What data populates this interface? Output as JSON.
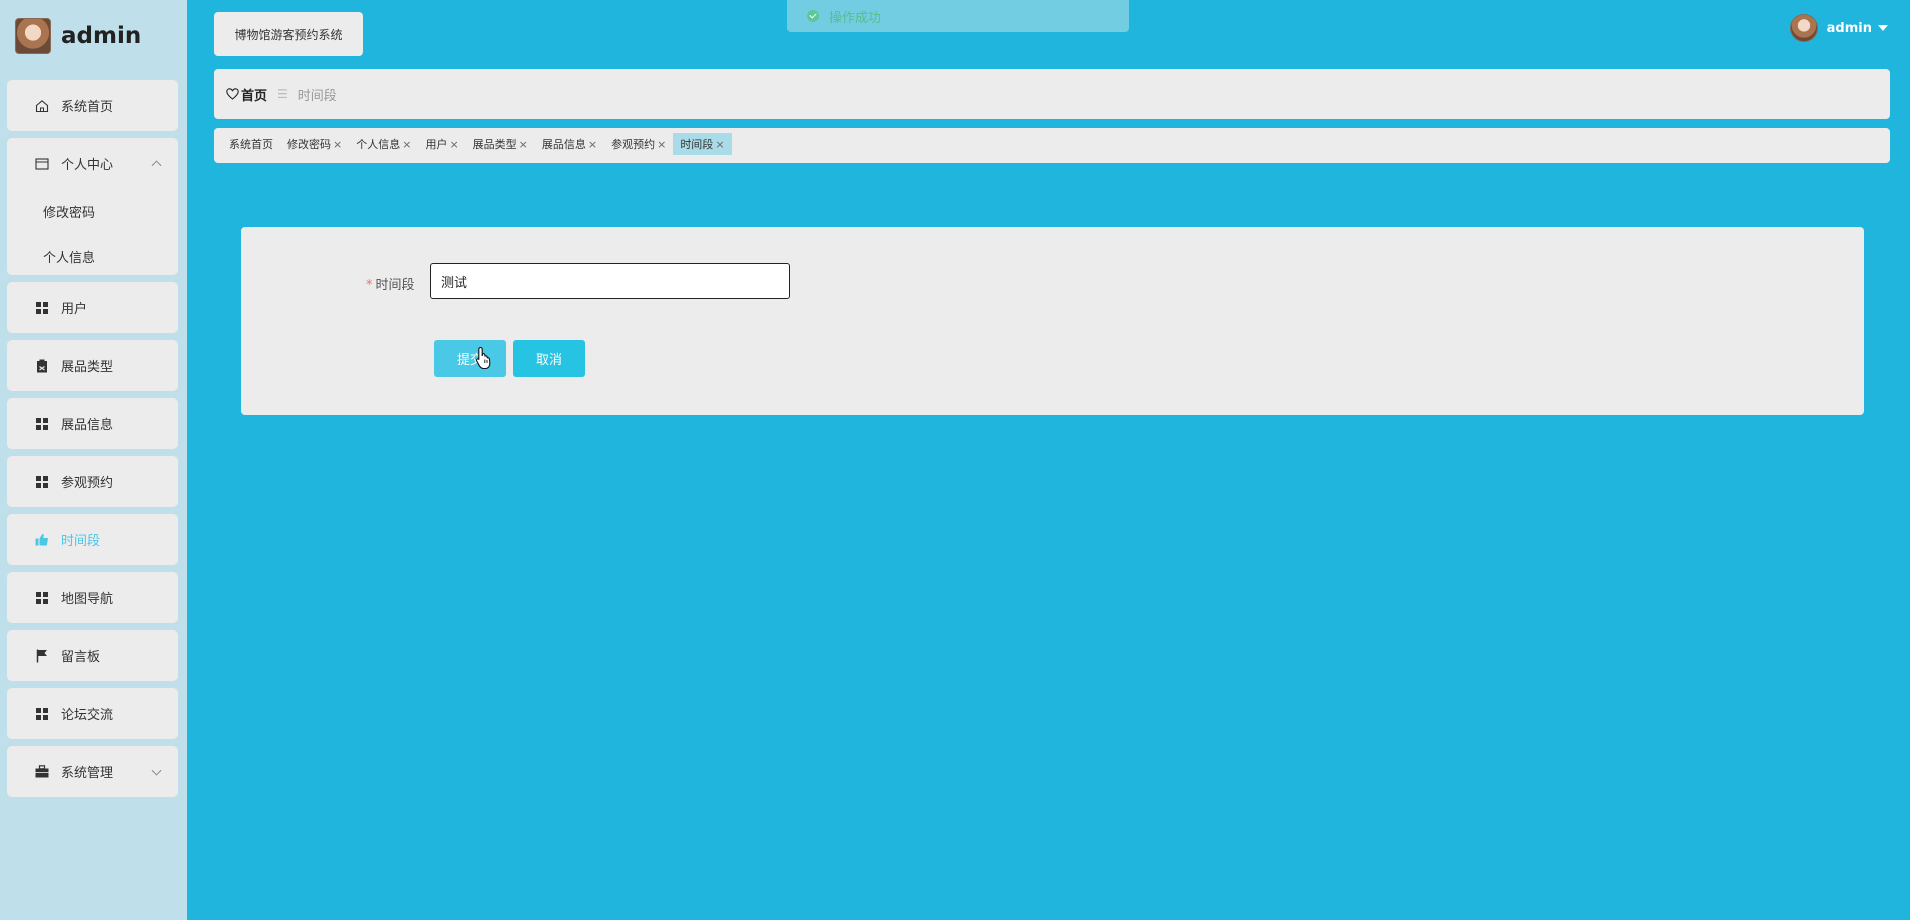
{
  "brand": {
    "name": "admin"
  },
  "header": {
    "system_title": "博物馆游客预约系统",
    "toast": "操作成功",
    "user_name": "admin"
  },
  "sidebar": {
    "home": "系统首页",
    "personal_center": {
      "label": "个人中心",
      "children": [
        "修改密码",
        "个人信息"
      ]
    },
    "items": [
      {
        "label": "用户",
        "icon": "grid-icon"
      },
      {
        "label": "展品类型",
        "icon": "clipboard-icon"
      },
      {
        "label": "展品信息",
        "icon": "grid-icon"
      },
      {
        "label": "参观预约",
        "icon": "grid-icon"
      },
      {
        "label": "时间段",
        "icon": "thumb-icon",
        "active": true
      },
      {
        "label": "地图导航",
        "icon": "grid-icon"
      },
      {
        "label": "留言板",
        "icon": "flag-icon"
      },
      {
        "label": "论坛交流",
        "icon": "grid-icon"
      }
    ],
    "system_management": "系统管理"
  },
  "breadcrumb": {
    "home": "首页",
    "separator": "☰",
    "current": "时间段"
  },
  "tabs": [
    {
      "label": "系统首页",
      "closable": false
    },
    {
      "label": "修改密码",
      "closable": true
    },
    {
      "label": "个人信息",
      "closable": true
    },
    {
      "label": "用户",
      "closable": true
    },
    {
      "label": "展品类型",
      "closable": true
    },
    {
      "label": "展品信息",
      "closable": true
    },
    {
      "label": "参观预约",
      "closable": true
    },
    {
      "label": "时间段",
      "closable": true,
      "active": true
    }
  ],
  "tab_close_glyph": "×",
  "form": {
    "required_mark": "*",
    "field_label": "时间段",
    "field_value": "测试",
    "submit_label": "提交",
    "cancel_label": "取消"
  },
  "colors": {
    "background": "#1fb5dc",
    "sidebar": "#bfe0ea",
    "panel": "#ececec",
    "accent": "#49c7e6",
    "active_tab": "#a9dbe9",
    "toast_text": "#55c08a",
    "required": "#f56c6c"
  }
}
